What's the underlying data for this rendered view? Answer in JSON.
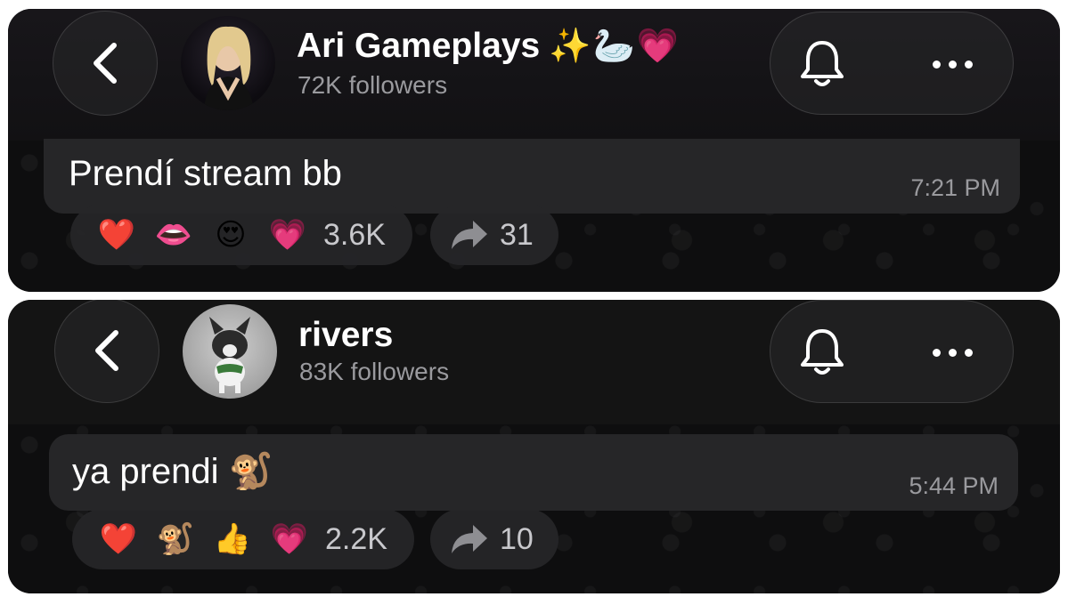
{
  "posts": [
    {
      "channel": {
        "name": "Ari Gameplays",
        "name_emojis": "✨🦢💗",
        "followers": "72K followers"
      },
      "message": {
        "text": "Prendí stream bb",
        "time": "7:21 PM"
      },
      "reactions": {
        "emojis": [
          "❤️",
          "👄",
          "😍",
          "💗"
        ],
        "count": "3.6K"
      },
      "shares": "31"
    },
    {
      "channel": {
        "name": "rivers",
        "name_emojis": "",
        "followers": "83K followers"
      },
      "message": {
        "text": "ya prendi 🐒",
        "time": "5:44 PM"
      },
      "reactions": {
        "emojis": [
          "❤️",
          "🐒",
          "👍",
          "💗"
        ],
        "count": "2.2K"
      },
      "shares": "10"
    }
  ],
  "icons": {
    "back": "chevron-left-icon",
    "bell": "bell-icon",
    "more": "more-horizontal-icon",
    "share": "share-arrow-icon"
  },
  "colors": {
    "panel_bg": "#0b0b0c",
    "bubble_bg": "#262628",
    "secondary_text": "#9a9a9e"
  }
}
